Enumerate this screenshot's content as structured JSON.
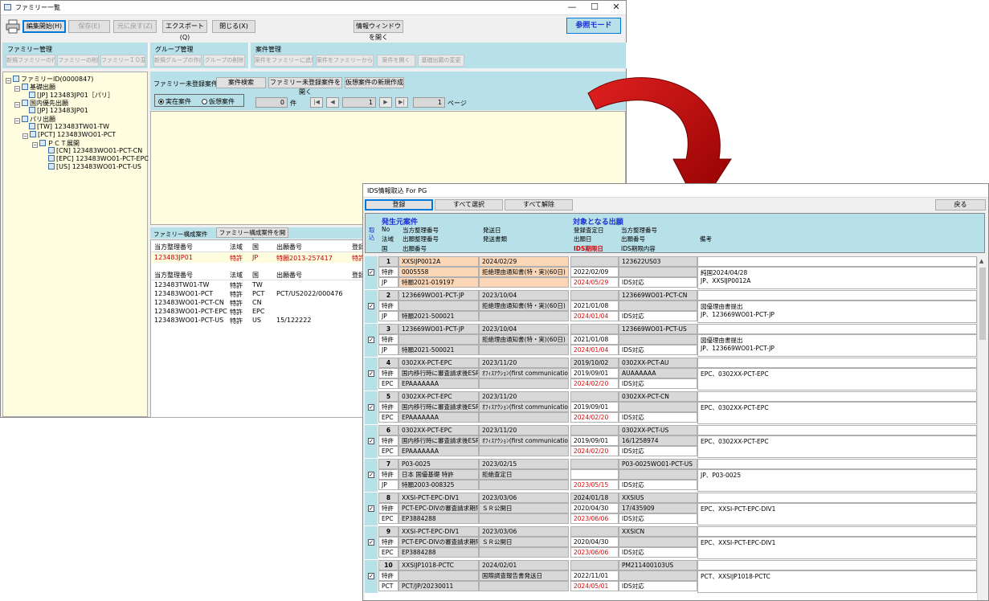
{
  "family_window": {
    "title": "ファミリー一覧",
    "toolbar": {
      "edit_start": "編集開始(H)",
      "save": "保存(E)",
      "undo": "元に戻す(Z)",
      "export": "エクスポート(Q)",
      "close": "閉じる(X)",
      "info_window": "情報ウィンドウを開く",
      "mode": "参照モード"
    },
    "groups": {
      "family": {
        "title": "ファミリー管理",
        "buttons": [
          "新規ファミリーの作成",
          "ファミリーの削除",
          "ファミリーＩＤ変更"
        ]
      },
      "group": {
        "title": "グループ管理",
        "buttons": [
          "新規グループの作成",
          "グループの削除"
        ]
      },
      "case": {
        "title": "案件管理",
        "buttons": [
          "案件をファミリーに追加",
          "案件をファミリーから外す",
          "案件を開く",
          "基礎出願の変更"
        ]
      }
    },
    "tree": [
      "ファミリーID(0000847)",
      "基礎出願",
      "[JP] 123483JP01［パリ］",
      "国内優先出願",
      "[JP] 123483JP01",
      "パリ出願",
      "[TW] 123483TW01-TW",
      "[PCT] 123483WO01-PCT",
      "ＰＣＴ展開",
      "[CN] 123483WO01-PCT-CN",
      "[EPC] 123483WO01-PCT-EPC",
      "[US] 123483WO01-PCT-US"
    ],
    "unregistered": {
      "title": "ファミリー未登録案件",
      "search": "案件検索",
      "open_unregistered": "ファミリー未登録案件を開く",
      "new_virtual": "仮想案件の新規作成",
      "radio_real": "実在案件",
      "radio_virtual": "仮想案件",
      "count": "0",
      "count_unit": "件",
      "page": "1",
      "page_total": "1",
      "page_unit": "ページ",
      "nav": [
        "|◀",
        "◀",
        "▶",
        "▶|"
      ]
    },
    "members": {
      "title": "ファミリー構成案件",
      "open_button": "ファミリー構成案件を開く",
      "headers": [
        "当方整理番号",
        "法域",
        "国",
        "出願番号",
        "登録"
      ],
      "top_row": [
        "123483JP01",
        "特許",
        "JP",
        "特願2013-257417",
        "特許"
      ],
      "rows": [
        [
          "123483TW01-TW",
          "特許",
          "TW",
          ""
        ],
        [
          "123483WO01-PCT",
          "特許",
          "PCT",
          "PCT/US2022/000476"
        ],
        [
          "123483WO01-PCT-CN",
          "特許",
          "CN",
          ""
        ],
        [
          "123483WO01-PCT-EPC",
          "特許",
          "EPC",
          ""
        ],
        [
          "123483WO01-PCT-US",
          "特許",
          "US",
          "15/122222"
        ]
      ]
    }
  },
  "ids_window": {
    "title": "IDS情報取込 For PG",
    "buttons": {
      "register": "登録",
      "select_all": "すべて選択",
      "deselect_all": "すべて解除",
      "back": "戻る"
    },
    "header": {
      "source_title": "発生元案件",
      "import_label": "取込",
      "no": "No",
      "our_ref": "当方整理番号",
      "send_date": "発送日",
      "legal": "法域",
      "app_ref": "出願整理番号",
      "send_doc": "発送書類",
      "country": "国",
      "app_no": "出願番号",
      "target_title": "対象となる出願",
      "reg_date": "登録査定日",
      "target_ref": "当方整理番号",
      "filing_date": "出願日",
      "filing_no": "出願番号",
      "ids_deadline": "IDS期限日",
      "ids_content": "IDS期限内容",
      "remarks": "備考"
    },
    "rows": [
      {
        "no": "1",
        "ref": "XXSIJP0012A",
        "date": "2024/02/29",
        "legal": "特許",
        "appref": "0005558",
        "doc": "拒絶理由通知書(特・実)(60日)",
        "country": "JP",
        "appno": "特願2021-019197",
        "regdate": "",
        "tref": "123622US03",
        "fdate": "2022/02/09",
        "fno": "",
        "deadline": "2024/05/29",
        "content": "IDS対応",
        "remarks1": "純国2024/04/28",
        "remarks2": "JP、XXSIJP0012A",
        "highlight": true
      },
      {
        "no": "2",
        "ref": "123669WO01-PCT-JP",
        "date": "2023/10/04",
        "legal": "特許",
        "appref": "",
        "doc": "拒絶理由通知書(特・実)(60日)",
        "country": "JP",
        "appno": "特願2021-500021",
        "regdate": "",
        "tref": "123669WO01-PCT-CN",
        "fdate": "2021/01/08",
        "fno": "",
        "deadline": "2024/01/04",
        "content": "IDS対応",
        "remarks1": "図優理由書提出",
        "remarks2": "JP、123669WO01-PCT-JP"
      },
      {
        "no": "3",
        "ref": "123669WO01-PCT-JP",
        "date": "2023/10/04",
        "legal": "特許",
        "appref": "",
        "doc": "拒絶理由通知書(特・実)(60日)",
        "country": "JP",
        "appno": "特願2021-500021",
        "regdate": "",
        "tref": "123669WO01-PCT-US",
        "fdate": "2021/01/08",
        "fno": "",
        "deadline": "2024/01/04",
        "content": "IDS対応",
        "remarks1": "図優理由書提出",
        "remarks2": "JP、123669WO01-PCT-JP"
      },
      {
        "no": "4",
        "ref": "0302XX-PCT-EPC",
        "date": "2023/11/20",
        "legal": "特許",
        "appref": "国内移行時に審査請求後ESR受",
        "doc": "ｵﾌｨｽｱｸｼｮﾝ(first communication)",
        "country": "EPC",
        "appno": "EPAAAAAAA",
        "regdate": "2019/10/02",
        "tref": "0302XX-PCT-AU",
        "fdate": "2019/09/01",
        "fno": "AUAAAAAA",
        "deadline": "2024/02/20",
        "content": "IDS対応",
        "remarks1": "EPC、0302XX-PCT-EPC",
        "remarks2": ""
      },
      {
        "no": "5",
        "ref": "0302XX-PCT-EPC",
        "date": "2023/11/20",
        "legal": "特許",
        "appref": "国内移行時に審査請求後ESR受",
        "doc": "ｵﾌｨｽｱｸｼｮﾝ(first communication)",
        "country": "EPC",
        "appno": "EPAAAAAAA",
        "regdate": "",
        "tref": "0302XX-PCT-CN",
        "fdate": "2019/09/01",
        "fno": "",
        "deadline": "2024/02/20",
        "content": "IDS対応",
        "remarks1": "EPC、0302XX-PCT-EPC",
        "remarks2": ""
      },
      {
        "no": "6",
        "ref": "0302XX-PCT-EPC",
        "date": "2023/11/20",
        "legal": "特許",
        "appref": "国内移行時に審査請求後ESR受",
        "doc": "ｵﾌｨｽｱｸｼｮﾝ(first communication)",
        "country": "EPC",
        "appno": "EPAAAAAAA",
        "regdate": "",
        "tref": "0302XX-PCT-US",
        "fdate": "2019/09/01",
        "fno": "16/1258974",
        "deadline": "2024/02/20",
        "content": "IDS対応",
        "remarks1": "EPC、0302XX-PCT-EPC",
        "remarks2": ""
      },
      {
        "no": "7",
        "ref": "P03-0025",
        "date": "2023/02/15",
        "legal": "特許",
        "appref": "日本 国優基礎 特許",
        "doc": "拒絶査定日",
        "country": "JP",
        "appno": "特願2003-008325",
        "regdate": "",
        "tref": "P03-0025WO01-PCT-US",
        "fdate": "",
        "fno": "",
        "deadline": "2023/05/15",
        "content": "IDS対応",
        "remarks1": "JP、P03-0025",
        "remarks2": ""
      },
      {
        "no": "8",
        "ref": "XXSI-PCT-EPC-DIV1",
        "date": "2023/03/06",
        "legal": "特許",
        "appref": "PCT-EPC-DIVの審査請求期限",
        "doc": "ＳＲ公開日",
        "country": "EPC",
        "appno": "EP3884288",
        "regdate": "2024/01/18",
        "tref": "XXSIUS",
        "fdate": "2020/04/30",
        "fno": "17/435909",
        "deadline": "2023/06/06",
        "content": "IDS対応",
        "remarks1": "EPC、XXSI-PCT-EPC-DIV1",
        "remarks2": ""
      },
      {
        "no": "9",
        "ref": "XXSI-PCT-EPC-DIV1",
        "date": "2023/03/06",
        "legal": "特許",
        "appref": "PCT-EPC-DIVの審査請求期限",
        "doc": "ＳＲ公開日",
        "country": "EPC",
        "appno": "EP3884288",
        "regdate": "",
        "tref": "XXSICN",
        "fdate": "2020/04/30",
        "fno": "",
        "deadline": "2023/06/06",
        "content": "IDS対応",
        "remarks1": "EPC、XXSI-PCT-EPC-DIV1",
        "remarks2": ""
      },
      {
        "no": "10",
        "ref": "XXSIJP1018-PCTC",
        "date": "2024/02/01",
        "legal": "特許",
        "appref": "",
        "doc": "国際調査報告書発送日",
        "country": "PCT",
        "appno": "PCT/JP/20230011",
        "regdate": "",
        "tref": "PM211400103US",
        "fdate": "2022/11/01",
        "fno": "",
        "deadline": "2024/05/01",
        "content": "IDS対応",
        "remarks1": "PCT、XXSIJP1018-PCTC",
        "remarks2": ""
      }
    ]
  },
  "colors": {
    "accent_cyan": "#b8e0e8",
    "panel_yellow": "#fffde0",
    "arrow_red": "#c00000",
    "highlight_orange": "#fbd7b8"
  }
}
